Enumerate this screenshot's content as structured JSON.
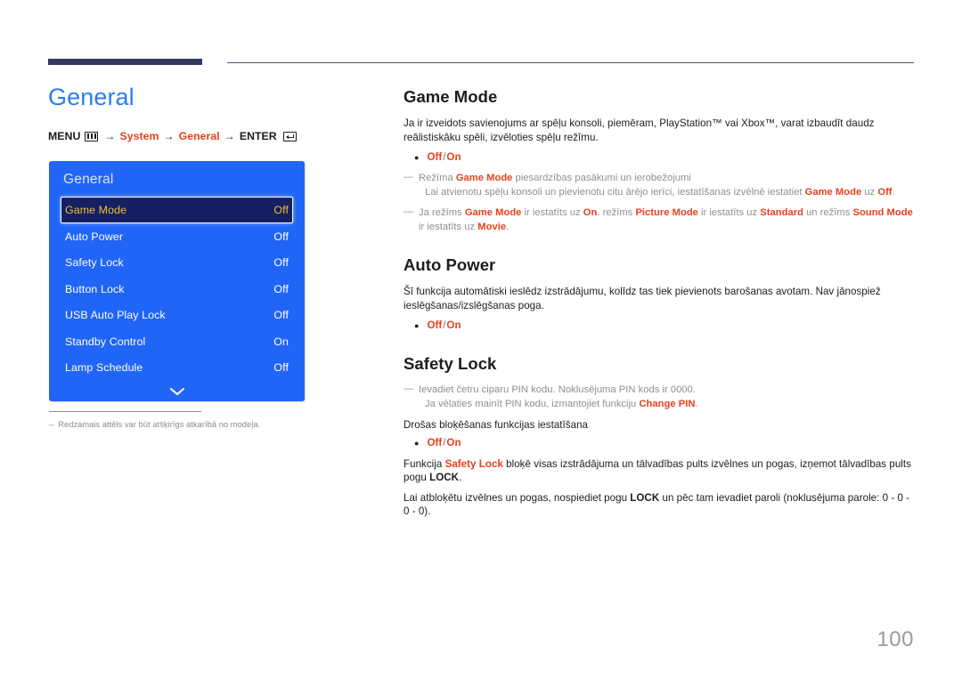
{
  "page": {
    "number": "100",
    "title": "General"
  },
  "breadcrumb": {
    "menu_label": "MENU",
    "menu_icon": "menu-grid-icon",
    "arrow": "→",
    "crumb1": "System",
    "crumb2": "General",
    "enter_label": "ENTER",
    "enter_icon": "enter-return-icon"
  },
  "osd": {
    "title": "General",
    "rows": [
      {
        "label": "Game Mode",
        "value": "Off",
        "selected": true
      },
      {
        "label": "Auto Power",
        "value": "Off",
        "selected": false
      },
      {
        "label": "Safety Lock",
        "value": "Off",
        "selected": false
      },
      {
        "label": "Button Lock",
        "value": "Off",
        "selected": false
      },
      {
        "label": "USB Auto Play Lock",
        "value": "Off",
        "selected": false
      },
      {
        "label": "Standby Control",
        "value": "On",
        "selected": false
      },
      {
        "label": "Lamp Schedule",
        "value": "Off",
        "selected": false
      }
    ],
    "more_icon": "chevron-down-icon"
  },
  "left_note": {
    "dash": "–",
    "text": "Redzamais attēls var būt atšķirīgs atkarībā no modeļa."
  },
  "sections": {
    "game_mode": {
      "heading": "Game Mode",
      "paragraph": "Ja ir izveidots savienojums ar spēļu konsoli, piemēram, PlayStation™ vai Xbox™, varat izbaudīt daudz reālistiskāku spēli, izvēloties spēļu režīmu.",
      "option_off": "Off",
      "option_sep": "/",
      "option_on": "On",
      "note1_a": "Režīma ",
      "note1_term": "Game Mode",
      "note1_b": " piesardzības pasākumi un ierobežojumi",
      "note1_sub_a": "Lai atvienotu spēļu konsoli un pievienotu citu ārējo ierīci, iestatīšanas izvēlnē iestatiet ",
      "note1_sub_term1": "Game Mode",
      "note1_sub_b": " uz ",
      "note1_sub_term2": "Off",
      "note1_sub_c": ".",
      "note2_a": "Ja režīms ",
      "note2_term1": "Game Mode",
      "note2_b": " ir iestatīts uz ",
      "note2_term2": "On",
      "note2_c": ". režīms ",
      "note2_term3": "Picture Mode",
      "note2_d": " ir iestatīts uz ",
      "note2_term4": "Standard",
      "note2_e": " un režīms ",
      "note2_term5": "Sound Mode",
      "note2_f": " ir iestatīts uz ",
      "note2_term6": "Movie",
      "note2_g": "."
    },
    "auto_power": {
      "heading": "Auto Power",
      "paragraph": "Šī funkcija automātiski ieslēdz izstrādājumu, kolīdz tas tiek pievienots barošanas avotam. Nav jānospiež ieslēgšanas/izslēgšanas poga.",
      "option_off": "Off",
      "option_sep": "/",
      "option_on": "On"
    },
    "safety_lock": {
      "heading": "Safety Lock",
      "note1_a": "Ievadiet četru ciparu PIN kodu. Noklusējuma PIN kods ir 0000.",
      "note1_sub_a": "Ja vēlaties mainīt PIN kodu, izmantojiet funkciju ",
      "note1_sub_term": "Change PIN",
      "note1_sub_b": ".",
      "subheading": "Drošas bloķēšanas funkcijas iestatīšana",
      "option_off": "Off",
      "option_sep": "/",
      "option_on": "On",
      "para2_a": "Funkcija ",
      "para2_term": "Safety Lock",
      "para2_b": " bloķē visas izstrādājuma un tālvadības pults izvēlnes un pogas, izņemot tālvadības pults pogu ",
      "para2_bold": "LOCK",
      "para2_c": ".",
      "para3_a": "Lai atbloķētu izvēlnes un pogas, nospiediet pogu ",
      "para3_bold": "LOCK",
      "para3_b": " un pēc tam ievadiet paroli (noklusējuma parole: 0 - 0 - 0 - 0)."
    }
  },
  "colors": {
    "accent_blue": "#2a7ef0",
    "osd_blue": "#2165f7",
    "osd_selected_bg": "#151f63",
    "osd_selected_text": "#f0c02a",
    "highlight_red": "#e8401e",
    "rule_navy": "#353a5f",
    "note_gray": "#8f8f8f"
  }
}
